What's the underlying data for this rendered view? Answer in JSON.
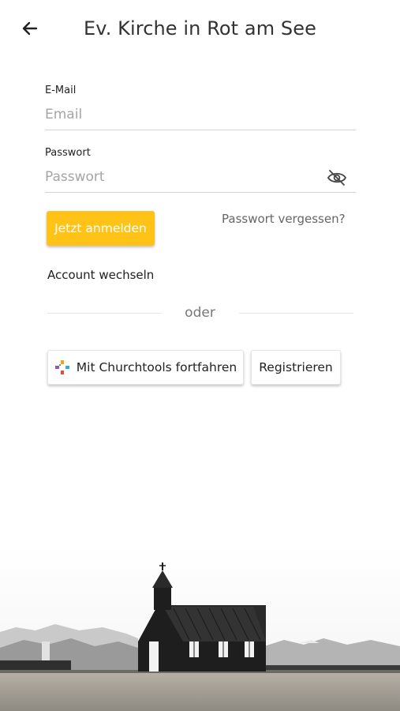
{
  "header": {
    "title": "Ev. Kirche in Rot am See",
    "back_icon": "arrow-left-icon"
  },
  "form": {
    "email": {
      "label": "E-Mail",
      "placeholder": "Email",
      "value": ""
    },
    "password": {
      "label": "Passwort",
      "placeholder": "Passwort",
      "value": "",
      "toggle_icon": "eye-off-icon"
    }
  },
  "actions": {
    "login_label": "Jetzt anmelden",
    "forgot_label": "Passwort vergessen?",
    "switch_account_label": "Account wechseln",
    "divider_label": "oder",
    "churchtools_label": "Mit Churchtools fortfahren",
    "churchtools_icon": "churchtools-logo-icon",
    "register_label": "Registrieren"
  },
  "colors": {
    "accent": "#ffc318",
    "church_body": "#1e1e1e"
  },
  "background_image": "church-landscape"
}
